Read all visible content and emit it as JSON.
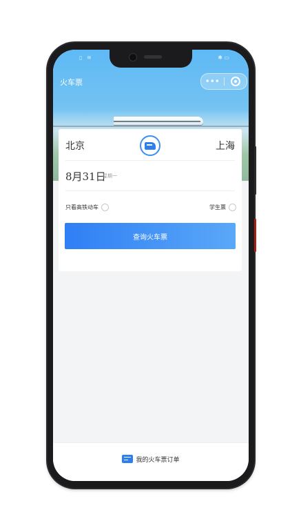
{
  "app": {
    "title": "火车票"
  },
  "status_bar": {
    "left": "▯ ≋",
    "right": "✱ ▭"
  },
  "capsule": {
    "more_label": "•••"
  },
  "search": {
    "from_station": "北京",
    "to_station": "上海",
    "date": "8月31日",
    "weekday": "星期一",
    "option_highspeed": "只看高铁动车",
    "option_student": "学生票",
    "query_button": "查询火车票"
  },
  "bottom": {
    "orders_label": "我的火车票订单"
  },
  "colors": {
    "accent": "#2d7ff0",
    "button_gradient_start": "#2f7ff5",
    "button_gradient_end": "#5aa8f8",
    "hero_blue": "#5eb9f5"
  },
  "icons": {
    "swap": "train-swap-icon",
    "more": "more-icon",
    "close": "close-target-icon",
    "orders": "ticket-icon"
  }
}
